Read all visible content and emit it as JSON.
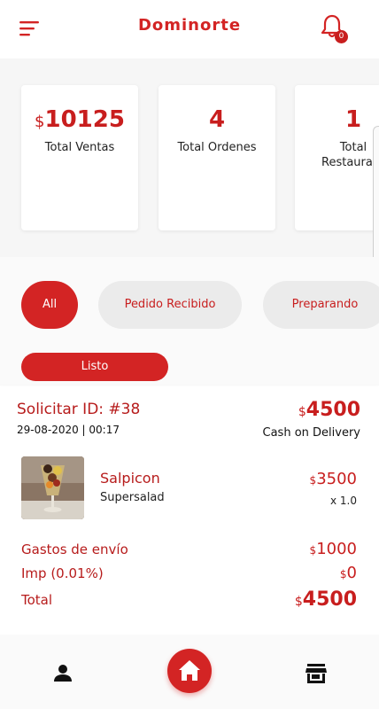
{
  "header": {
    "title": "Dominorte",
    "notification_count": "0",
    "menu_icon": "menu-icon",
    "bell_icon": "bell-icon"
  },
  "stats": [
    {
      "currency": "$",
      "value": "10125",
      "label": "Total Ventas"
    },
    {
      "currency": "",
      "value": "4",
      "label": "Total Ordenes"
    },
    {
      "currency": "",
      "value": "1",
      "label": "Total Restaurante"
    }
  ],
  "filters": {
    "all": "All",
    "recibido": "Pedido Recibido",
    "preparando": "Preparando",
    "listo": "Listo"
  },
  "order": {
    "id_label": "Solicitar ID: #38",
    "date": "29-08-2020 | 00:17",
    "currency": "$",
    "total": "4500",
    "payment": "Cash on Delivery",
    "item": {
      "name": "Salpicon",
      "subtitle": "Supersalad",
      "price": "3500",
      "qty": "x 1.0"
    },
    "shipping_label": "Gastos de envío",
    "shipping_value": "1000",
    "tax_label": "Imp (0.01%)",
    "tax_value": "0",
    "total_label": "Total",
    "total_value": "4500"
  },
  "nav": {
    "profile_icon": "person-icon",
    "home_icon": "home-icon",
    "store_icon": "store-icon"
  },
  "colors": {
    "accent": "#d32424",
    "chip_inactive": "#ebebeb"
  }
}
